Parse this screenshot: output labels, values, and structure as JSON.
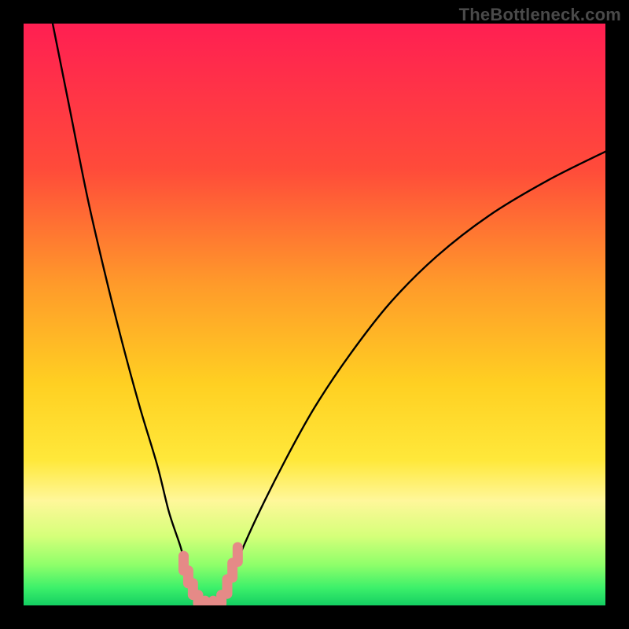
{
  "watermark": {
    "text": "TheBottleneck.com"
  },
  "chart_data": {
    "type": "line",
    "title": "",
    "xlabel": "",
    "ylabel": "",
    "xlim": [
      0,
      100
    ],
    "ylim": [
      0,
      100
    ],
    "grid": false,
    "background_gradient": {
      "direction": "vertical",
      "stops": [
        {
          "offset": 0.0,
          "color": "#ff1f52"
        },
        {
          "offset": 0.25,
          "color": "#ff4b3a"
        },
        {
          "offset": 0.45,
          "color": "#ff9b2a"
        },
        {
          "offset": 0.62,
          "color": "#ffd022"
        },
        {
          "offset": 0.75,
          "color": "#ffe83a"
        },
        {
          "offset": 0.82,
          "color": "#fff79a"
        },
        {
          "offset": 0.88,
          "color": "#d6ff7a"
        },
        {
          "offset": 0.93,
          "color": "#8fff6a"
        },
        {
          "offset": 0.97,
          "color": "#3cf06a"
        },
        {
          "offset": 1.0,
          "color": "#14cf62"
        }
      ]
    },
    "series": [
      {
        "name": "bottleneck-left",
        "type": "line",
        "color": "#000000",
        "x": [
          5,
          8,
          11,
          14,
          17,
          20,
          23,
          25,
          27,
          28,
          29,
          30
        ],
        "y": [
          100,
          85,
          70,
          57,
          45,
          34,
          24,
          16,
          10,
          6,
          3,
          1
        ]
      },
      {
        "name": "bottleneck-right",
        "type": "line",
        "color": "#000000",
        "x": [
          34,
          36,
          40,
          45,
          50,
          56,
          63,
          71,
          80,
          90,
          100
        ],
        "y": [
          1,
          6,
          15,
          25,
          34,
          43,
          52,
          60,
          67,
          73,
          78
        ]
      },
      {
        "name": "optimal-floor",
        "type": "line",
        "color": "#000000",
        "x": [
          30,
          31,
          32,
          33,
          34
        ],
        "y": [
          1,
          0,
          0,
          0,
          1
        ]
      }
    ],
    "markers": {
      "name": "highlighted-points",
      "color": "#e58a87",
      "shape": "rounded-bar",
      "points": [
        {
          "x": 27.5,
          "y_top": 8.5,
          "y_bottom": 6.0
        },
        {
          "x": 28.3,
          "y_top": 6.0,
          "y_bottom": 3.8
        },
        {
          "x": 29.1,
          "y_top": 3.8,
          "y_bottom": 1.8
        },
        {
          "x": 30.0,
          "y_top": 1.8,
          "y_bottom": 0.3
        },
        {
          "x": 31.2,
          "y_top": 0.8,
          "y_bottom": -0.2
        },
        {
          "x": 32.6,
          "y_top": 0.8,
          "y_bottom": -0.2
        },
        {
          "x": 34.0,
          "y_top": 1.8,
          "y_bottom": 0.3
        },
        {
          "x": 35.0,
          "y_top": 4.5,
          "y_bottom": 2.0
        },
        {
          "x": 35.9,
          "y_top": 7.3,
          "y_bottom": 4.8
        },
        {
          "x": 36.8,
          "y_top": 10.0,
          "y_bottom": 7.5
        }
      ]
    }
  }
}
